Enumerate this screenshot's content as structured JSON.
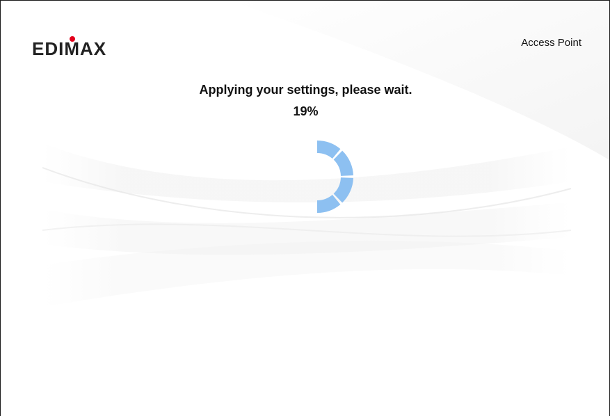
{
  "header": {
    "brand": "EDIMAX",
    "mode_label": "Access Point"
  },
  "status": {
    "message": "Applying your settings, please wait.",
    "progress_text": "19%",
    "progress": 0.19
  },
  "colors": {
    "spinner": "#8dc0f1",
    "logo_dot": "#e3001b",
    "text": "#111111"
  },
  "icons": {
    "loading": "spinner-icon"
  }
}
